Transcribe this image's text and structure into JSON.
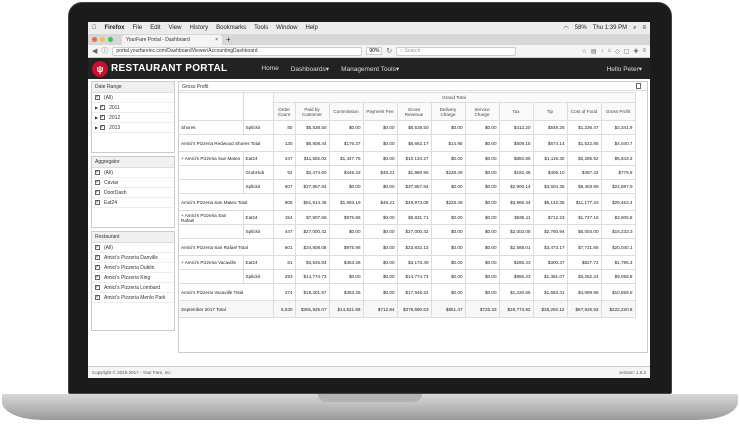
{
  "menubar": {
    "apple": "",
    "app": "Firefox",
    "items": [
      "File",
      "Edit",
      "View",
      "History",
      "Bookmarks",
      "Tools",
      "Window",
      "Help"
    ],
    "battery": "58%",
    "clock": "Thu 1:39 PM"
  },
  "browser": {
    "tab_title": "YourFare Portal - Dashboard",
    "url": "portal.yourfareinc.com/DashboardViewer/AccountingDashboard",
    "zoom": "90%",
    "search_placeholder": "Search"
  },
  "app": {
    "brand": "RESTAURANT PORTAL",
    "nav": [
      "Home",
      "Dashboards",
      "Management Tools"
    ],
    "greeting": "Hello Peter"
  },
  "sidebar": {
    "date_range": {
      "title": "Date Range",
      "all": "(All)",
      "years": [
        "2011",
        "2012",
        "2013"
      ]
    },
    "aggregator": {
      "title": "Aggregator",
      "items": [
        "(All)",
        "Caviar",
        "DoorDash",
        "Eat24"
      ]
    },
    "restaurant": {
      "title": "Restaurant",
      "items": [
        "(All)",
        "Amici's Pizzeria Danville",
        "Amici's Pizzeria Dublin",
        "Amici's Pizzeria King",
        "Amici's Pizzeria Lombard",
        "Amici's Pizzeria Menlo Park"
      ]
    }
  },
  "report": {
    "title": "Gross Profit",
    "grand_total": "Grand Total",
    "columns": [
      "Order Count",
      "Paid by Customer",
      "Commission",
      "Payment Fee",
      "Gross Revenue",
      "Delivery Charge",
      "Service Charge",
      "Tax",
      "Tip",
      "Cost of Food",
      "Gross Profit"
    ],
    "rows": [
      {
        "l1": "Shores",
        "l2": "Splickit",
        "vals": [
          "80",
          "$5,538.50",
          "$0.00",
          "$0.00",
          "$5,538.50",
          "$0.00",
          "$0.00",
          "$412.20",
          "$548.25",
          "$1,236.47",
          "$3,341.9"
        ]
      },
      {
        "l1": "Amici's Pizzeria Redwood Shores Total",
        "l2": "",
        "vals": [
          "130",
          "$6,808.44",
          "$176.37",
          "$0.00",
          "$6,662.17",
          "$14.95",
          "$0.00",
          "$509.15",
          "$674.14",
          "$1,522.85",
          "$4,040.7"
        ]
      },
      {
        "l1": "+ Amici's Pizzeria San Mateo",
        "l2": "Eat24",
        "vals": [
          "247",
          "$11,582.02",
          "$1,447.76",
          "$0.00",
          "$10,134.27",
          "$0.00",
          "$0.00",
          "$882.85",
          "$1,119.30",
          "$2,285.92",
          "$5,843.3"
        ]
      },
      {
        "l1": "",
        "l2": "GrubHub",
        "vals": [
          "52",
          "$2,474.60",
          "$445.43",
          "$48.21",
          "$1,980.96",
          "$228.49",
          "$0.00",
          "$182.48",
          "$406.10",
          "$487.42",
          "$779.9"
        ]
      },
      {
        "l1": "",
        "l2": "Splickit",
        "vals": [
          "607",
          "$37,857.84",
          "$0.00",
          "$0.00",
          "$37,857.84",
          "$0.00",
          "$0.00",
          "$2,900.14",
          "$3,604.35",
          "$8,403.99",
          "$22,887.9"
        ]
      },
      {
        "l1": "Amici's Pizzeria San Mateo Total",
        "l2": "",
        "vals": [
          "906",
          "$51,914.45",
          "$1,893.19",
          "$48.21",
          "$49,973.08",
          "$228.49",
          "$0.00",
          "$3,966.44",
          "$5,142.35",
          "$11,177.33",
          "$29,463.4"
        ]
      },
      {
        "l1": "+ Amici's Pizzeria San Rafael",
        "l2": "Eat24",
        "vals": [
          "154",
          "$7,807.66",
          "$975.96",
          "$0.00",
          "$6,831.71",
          "$0.00",
          "$0.00",
          "$585.11",
          "$712.23",
          "$1,727.16",
          "$3,806.8"
        ]
      },
      {
        "l1": "",
        "l2": "Splickit",
        "vals": [
          "447",
          "$27,000.42",
          "$0.00",
          "$0.00",
          "$27,000.42",
          "$0.00",
          "$0.00",
          "$2,002.08",
          "$2,760.94",
          "$6,004.00",
          "$16,233.3"
        ]
      },
      {
        "l1": "Amici's Pizzeria San Rafael Total",
        "l2": "",
        "vals": [
          "601",
          "$34,808.08",
          "$975.96",
          "$0.00",
          "$33,832.13",
          "$0.00",
          "$0.00",
          "$2,588.01",
          "$3,473.17",
          "$7,731.66",
          "$20,040.1"
        ]
      },
      {
        "l1": "+ Amici's Pizzeria Vacaville",
        "l2": "Eat24",
        "vals": [
          "81",
          "$3,626.84",
          "$453.36",
          "$0.00",
          "$3,173.49",
          "$0.00",
          "$0.00",
          "$265.43",
          "$300.37",
          "$827.72",
          "$1,796.3"
        ]
      },
      {
        "l1": "",
        "l2": "Splickit",
        "vals": [
          "293",
          "$14,774.73",
          "$0.00",
          "$0.00",
          "$14,774.73",
          "$0.00",
          "$0.00",
          "$955.23",
          "$1,381.07",
          "$3,262.24",
          "$9,058.8"
        ]
      },
      {
        "l1": "Amici's Pizzeria Vacaville Total",
        "l2": "",
        "vals": [
          "374",
          "$18,401.57",
          "$453.36",
          "$0.00",
          "$17,948.22",
          "$0.00",
          "$0.00",
          "$1,220.66",
          "$1,683.41",
          "$4,089.96",
          "$10,859.8"
        ]
      },
      {
        "l1": "September 2017 Total",
        "l2": "",
        "vals": [
          "6,530",
          "$391,925.07",
          "$14,521.69",
          "$712.84",
          "$376,690.63",
          "$851.47",
          "$726.33",
          "$28,773.92",
          "$36,292.12",
          "$87,825.93",
          "$222,220.8"
        ]
      }
    ]
  },
  "footer": {
    "copyright": "Copyright © 2015-2017 - Your Fare, Inc.",
    "version": "version: 1.6.2"
  }
}
